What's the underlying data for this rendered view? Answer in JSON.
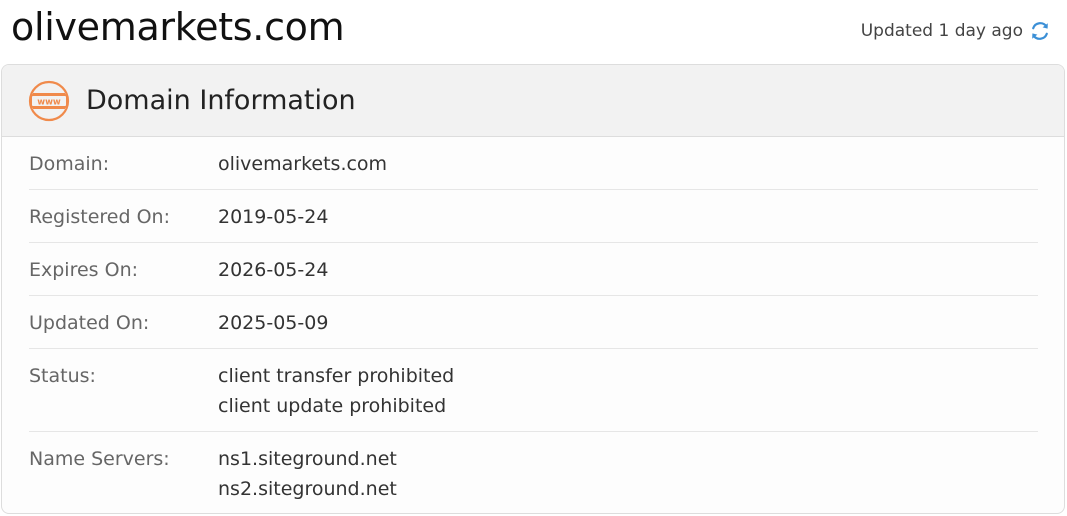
{
  "header": {
    "site_title": "olivemarkets.com",
    "updated_text": "Updated 1 day ago",
    "refresh_icon": "refresh-icon"
  },
  "panel": {
    "title": "Domain Information",
    "icon": "www-icon",
    "rows": [
      {
        "label": "Domain:",
        "values": [
          "olivemarkets.com"
        ]
      },
      {
        "label": "Registered On:",
        "values": [
          "2019-05-24"
        ]
      },
      {
        "label": "Expires On:",
        "values": [
          "2026-05-24"
        ]
      },
      {
        "label": "Updated On:",
        "values": [
          "2025-05-09"
        ]
      },
      {
        "label": "Status:",
        "values": [
          "client transfer prohibited",
          "client update prohibited"
        ]
      },
      {
        "label": "Name Servers:",
        "values": [
          "ns1.siteground.net",
          "ns2.siteground.net"
        ]
      }
    ]
  },
  "colors": {
    "accent_orange": "#f08a4b",
    "refresh_blue": "#3b8fd6"
  }
}
